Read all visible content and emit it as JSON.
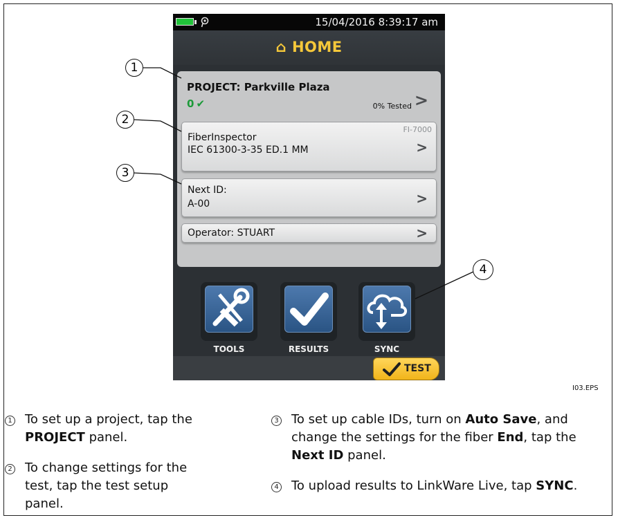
{
  "device": {
    "status_time": "15/04/2016 8:39:17 am",
    "title": "HOME",
    "project": {
      "label": "PROJECT: Parkville Plaza",
      "pass_count": "0",
      "percent": "0% Tested"
    },
    "setup": {
      "line1": "FiberInspector",
      "line2": "IEC 61300-3-35 ED.1 MM",
      "model": "FI-7000"
    },
    "next_id": {
      "line1": "Next ID:",
      "line2": "A-00"
    },
    "operator": "Operator: STUART",
    "buttons": {
      "tools": "TOOLS",
      "results": "RESULTS",
      "sync": "SYNC",
      "test": "TEST"
    }
  },
  "callouts": [
    "1",
    "2",
    "3",
    "4"
  ],
  "figure_id": "I03.EPS",
  "legend": [
    {
      "num": "1",
      "parts": [
        "To set up a project, tap the ",
        "PROJECT",
        " panel."
      ]
    },
    {
      "num": "2",
      "parts": [
        "To change settings for the test, tap the test setup panel."
      ]
    },
    {
      "num": "3",
      "parts": [
        "To set up cable IDs, turn on ",
        "Auto Save",
        ", and change the settings for the fiber ",
        "End",
        ", tap the ",
        "Next ID",
        " panel."
      ]
    },
    {
      "num": "4",
      "parts": [
        "To upload results to LinkWare Live, tap ",
        "SYNC",
        "."
      ]
    }
  ],
  "colors": {
    "accent_yellow": "#f5c83a",
    "pass_green": "#1d9a3a",
    "button_blue": "#3a679b"
  }
}
